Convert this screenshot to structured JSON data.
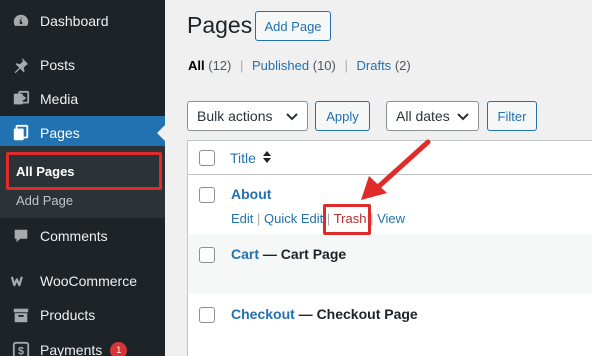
{
  "sidebar": {
    "items": [
      {
        "label": "Dashboard",
        "icon": "dashboard-icon"
      },
      {
        "label": "Posts",
        "icon": "pin-icon"
      },
      {
        "label": "Media",
        "icon": "media-icon"
      },
      {
        "label": "Pages",
        "icon": "pages-icon"
      },
      {
        "label": "Comments",
        "icon": "comment-icon"
      },
      {
        "label": "WooCommerce",
        "icon": "woocommerce-icon"
      },
      {
        "label": "Products",
        "icon": "archive-icon"
      },
      {
        "label": "Payments",
        "icon": "dollar-icon",
        "badge": "1"
      }
    ],
    "submenu": [
      {
        "label": "All Pages"
      },
      {
        "label": "Add Page"
      }
    ]
  },
  "header": {
    "title": "Pages",
    "add_button": "Add Page"
  },
  "views": [
    {
      "label": "All",
      "count": "(12)"
    },
    {
      "label": "Published",
      "count": "(10)"
    },
    {
      "label": "Drafts",
      "count": "(2)"
    }
  ],
  "views_separator": "|",
  "filters": {
    "bulk_actions": "Bulk actions",
    "apply": "Apply",
    "dates": "All dates",
    "filter": "Filter"
  },
  "table": {
    "title_header": "Title",
    "rows": [
      {
        "title": "About",
        "state": ""
      },
      {
        "title": "Cart",
        "state": " — Cart Page"
      },
      {
        "title": "Checkout",
        "state": " — Checkout Page"
      }
    ],
    "row_actions": {
      "edit": "Edit",
      "quick_edit": "Quick Edit",
      "trash": "Trash",
      "view": "View",
      "sep": "|"
    }
  },
  "colors": {
    "sidebar_bg": "#1d2327",
    "accent": "#2271b1",
    "highlight": "#e02b2b",
    "trash": "#b32d2e"
  }
}
